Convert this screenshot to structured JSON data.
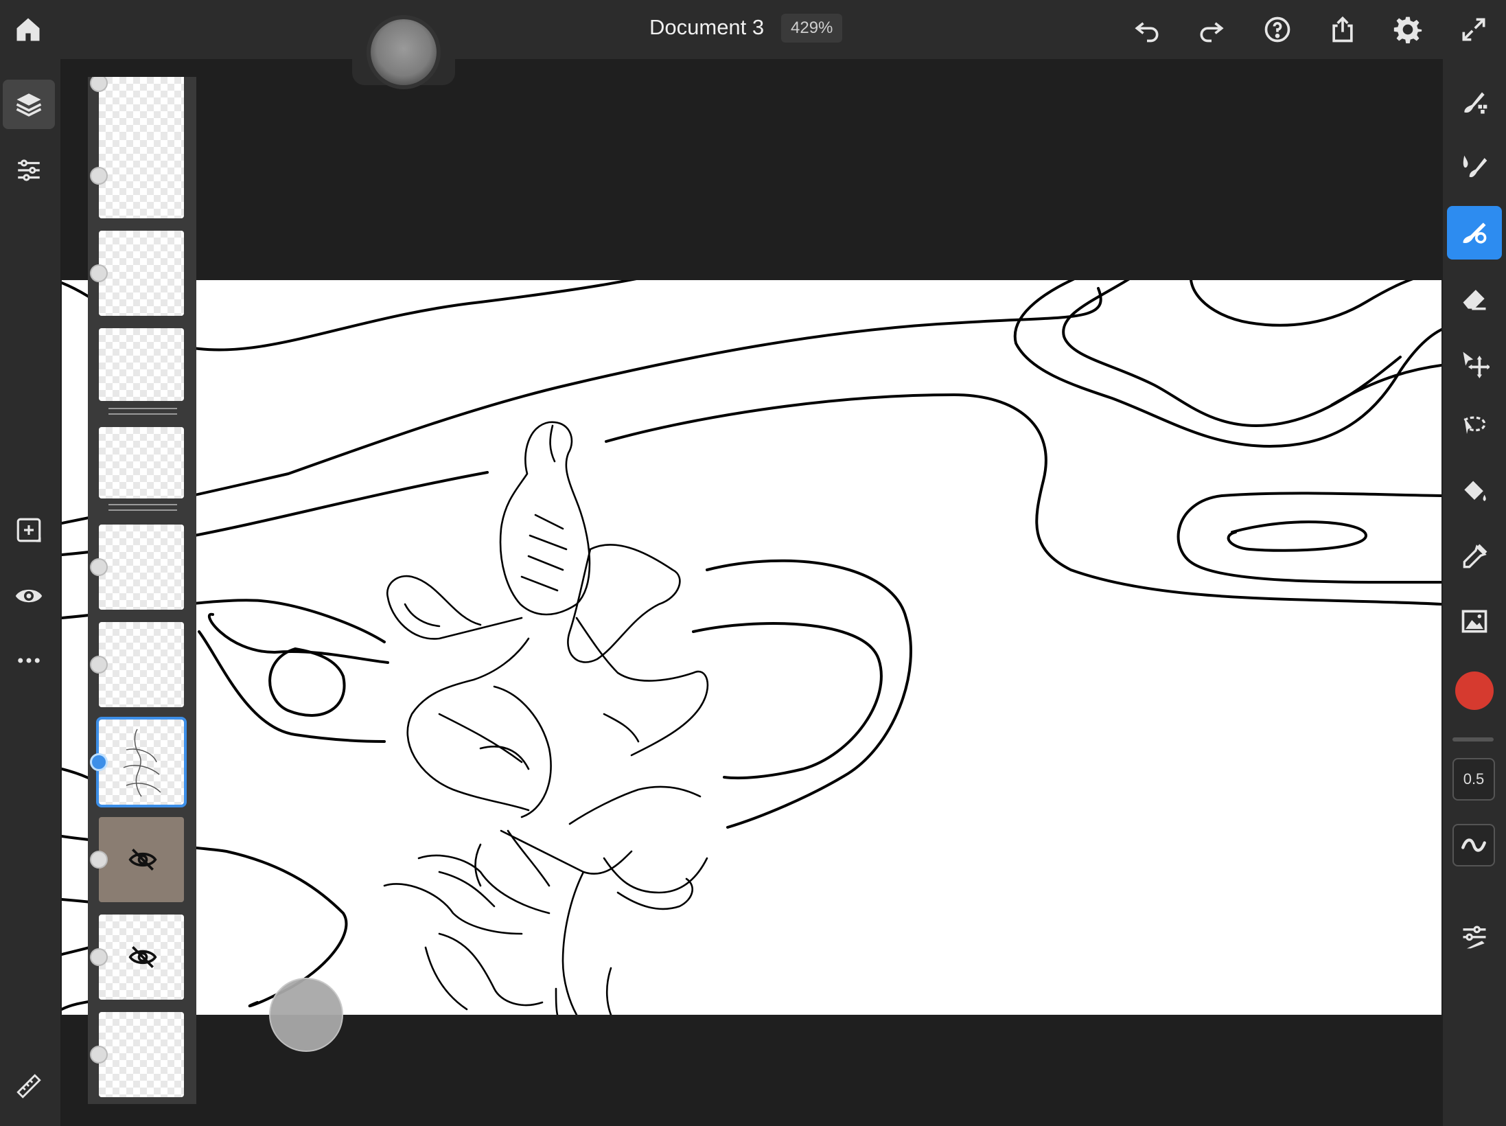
{
  "app": {
    "document_title": "Document 3",
    "zoom": "429%"
  },
  "topbar": {
    "icons": [
      "home-icon",
      "undo-icon",
      "redo-icon",
      "help-icon",
      "share-icon",
      "settings-icon",
      "fullscreen-icon"
    ]
  },
  "left_rail": {
    "icons": [
      "layers-icon",
      "adjustments-icon",
      "add-layer-icon",
      "visibility-icon",
      "more-icon",
      "ruler-icon"
    ]
  },
  "layers": [
    {
      "state": "partial"
    },
    {
      "state": "normal"
    },
    {
      "state": "normal"
    },
    {
      "state": "group"
    },
    {
      "state": "group"
    },
    {
      "state": "normal"
    },
    {
      "state": "normal"
    },
    {
      "state": "selected"
    },
    {
      "state": "hidden-image"
    },
    {
      "state": "hidden"
    },
    {
      "state": "image"
    }
  ],
  "right_rail": {
    "tools": [
      "pixel-brush-icon",
      "live-brush-icon",
      "vector-brush-icon",
      "eraser-icon",
      "transform-icon",
      "lasso-icon",
      "fill-icon",
      "eyedropper-icon",
      "image-icon"
    ],
    "active_tool": "vector-brush-icon",
    "brush_size": "0.5",
    "colors": {
      "brush_color": "#d63a2f",
      "accent": "#2d8cf0"
    }
  }
}
